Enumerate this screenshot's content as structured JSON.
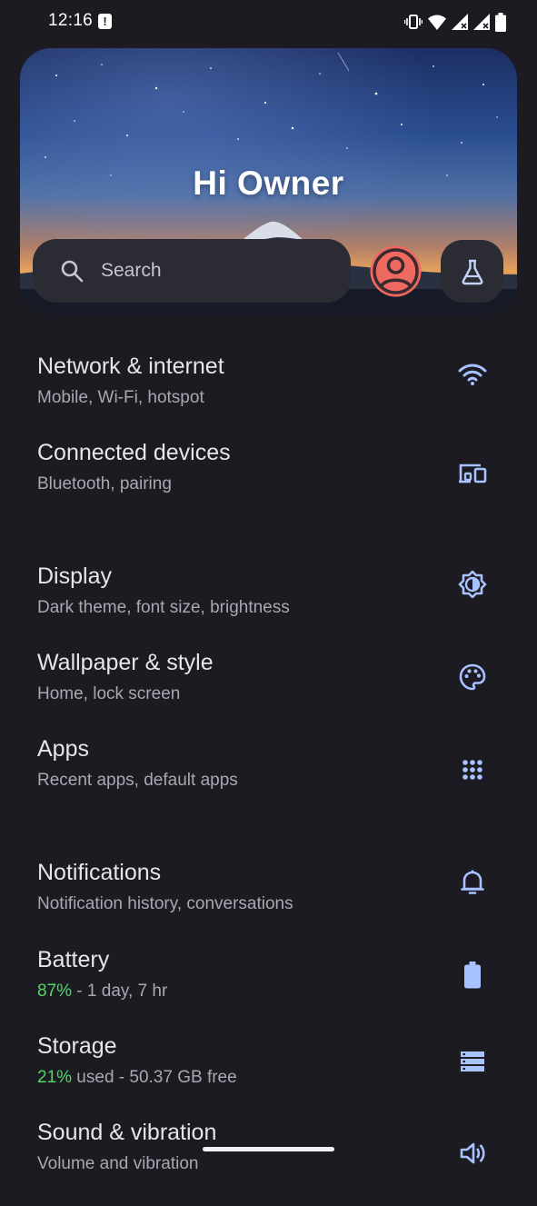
{
  "status_bar": {
    "time": "12:16",
    "alert_glyph": "!"
  },
  "header": {
    "greeting": "Hi Owner",
    "search_placeholder": "Search",
    "avatar_icon": "account-circle-icon",
    "labs_icon": "flask-icon"
  },
  "settings": [
    {
      "id": "network",
      "title": "Network & internet",
      "subtitle": "Mobile, Wi-Fi, hotspot",
      "icon": "wifi-icon"
    },
    {
      "id": "connected-devices",
      "title": "Connected devices",
      "subtitle": "Bluetooth, pairing",
      "icon": "devices-icon"
    },
    {
      "id": "display",
      "title": "Display",
      "subtitle": "Dark theme, font size, brightness",
      "icon": "brightness-icon"
    },
    {
      "id": "wallpaper",
      "title": "Wallpaper & style",
      "subtitle": "Home, lock screen",
      "icon": "palette-icon"
    },
    {
      "id": "apps",
      "title": "Apps",
      "subtitle": "Recent apps, default apps",
      "icon": "apps-grid-icon"
    },
    {
      "id": "notifications",
      "title": "Notifications",
      "subtitle": "Notification history, conversations",
      "icon": "bell-icon"
    },
    {
      "id": "battery",
      "title": "Battery",
      "subtitle_highlight": "87%",
      "subtitle_rest": " - 1 day, 7 hr",
      "icon": "battery-icon"
    },
    {
      "id": "storage",
      "title": "Storage",
      "subtitle_highlight": "21%",
      "subtitle_rest": " used - 50.37 GB free",
      "icon": "storage-icon"
    },
    {
      "id": "sound",
      "title": "Sound & vibration",
      "subtitle": "Volume and vibration",
      "icon": "volume-icon"
    }
  ],
  "colors": {
    "accent_icon": "#a8c1ff",
    "highlight_green": "#4cd964",
    "background": "#1b1b21"
  }
}
